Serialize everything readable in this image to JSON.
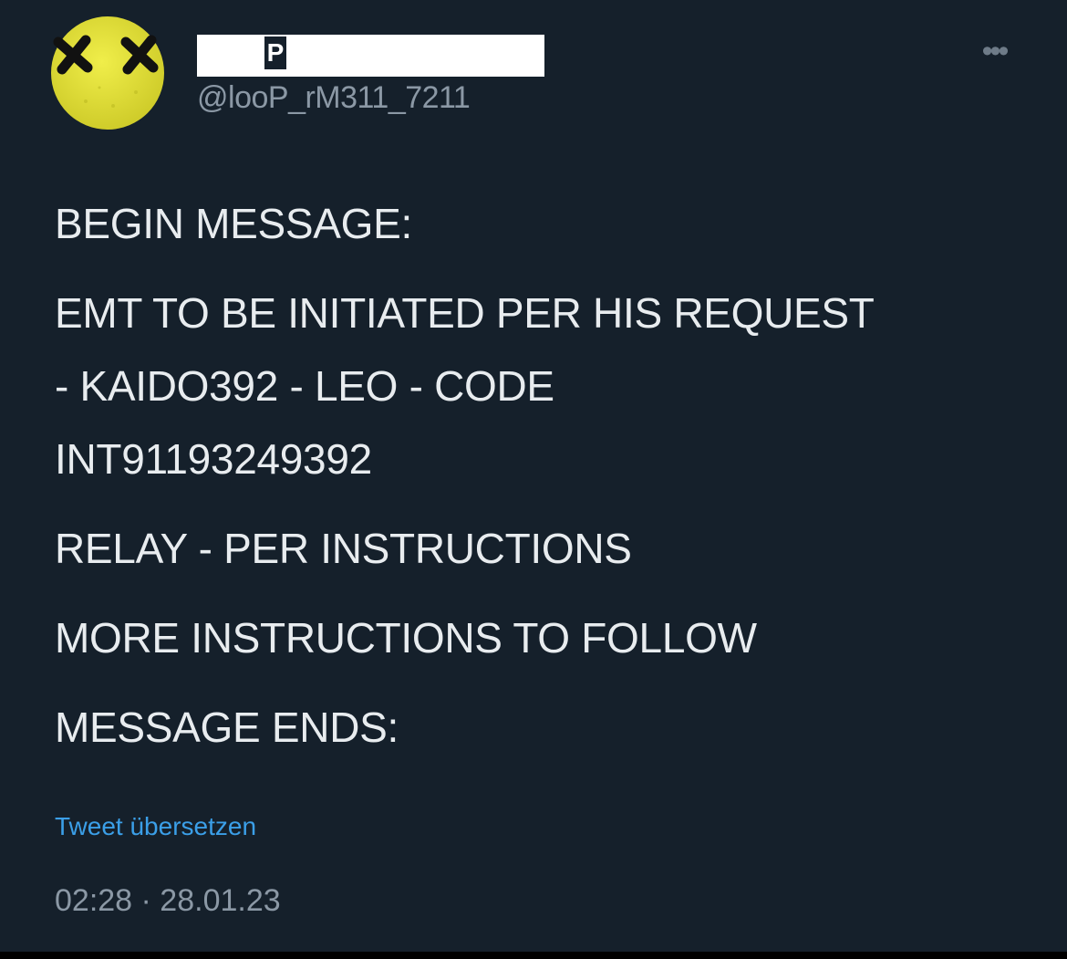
{
  "author": {
    "display_name_visible": "P",
    "handle": "@looP_rM311_7211"
  },
  "icons": {
    "avatar": "dead-smiley-avatar",
    "more": "more-options-icon"
  },
  "more_glyph": "•••",
  "message": {
    "line1": "BEGIN MESSAGE:",
    "line2": "EMT TO BE INITIATED PER HIS REQUEST",
    "line3": "- KAIDO392 - LEO - CODE",
    "line4": "INT91193249392",
    "line5": "RELAY - PER INSTRUCTIONS",
    "line6": "MORE INSTRUCTIONS TO FOLLOW",
    "line7": "MESSAGE ENDS:"
  },
  "translate_label": "Tweet übersetzen",
  "timestamp": "02:28 · 28.01.23",
  "colors": {
    "background": "#15202b",
    "text": "#e8ecef",
    "secondary": "#8b98a5",
    "link": "#3b9fe8",
    "avatar_yellow": "#e6e43a"
  }
}
